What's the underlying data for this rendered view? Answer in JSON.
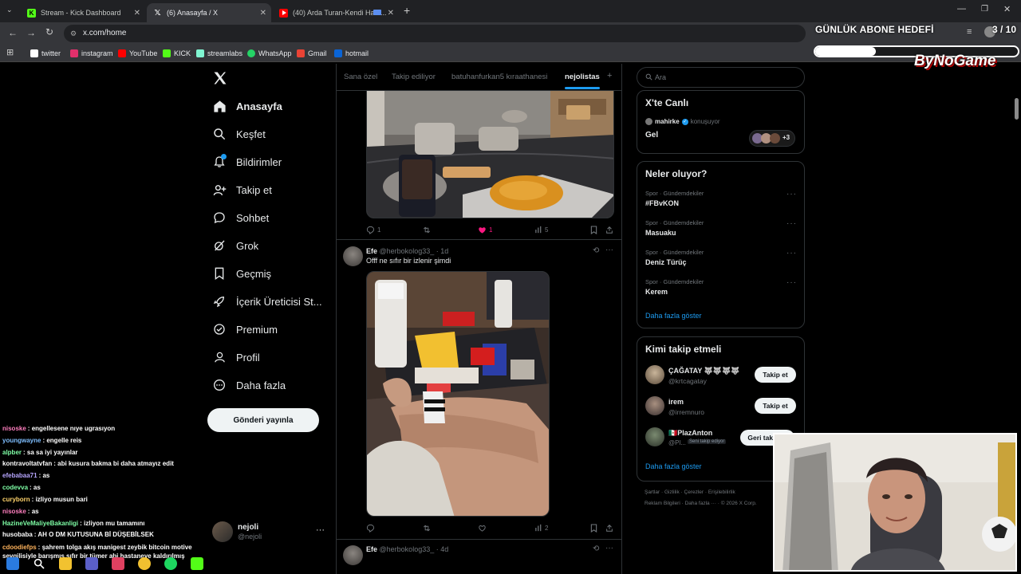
{
  "browser": {
    "tabs": [
      {
        "label": "Stream - Kick Dashboard",
        "favicon": "kick-icon",
        "color": "#53fc18"
      },
      {
        "label": "(6) Anasayfa / X",
        "favicon": "x-icon",
        "color": "#ffffff"
      },
      {
        "label": "(40) Arda Turan-Kendi Hata...",
        "favicon": "youtube-icon",
        "color": "#ff0000"
      }
    ],
    "url": "x.com/home",
    "bookmarks": [
      {
        "label": "twitter",
        "color": "#ffffff"
      },
      {
        "label": "instagram",
        "color": "#e1306c"
      },
      {
        "label": "YouTube",
        "color": "#ff0000"
      },
      {
        "label": "KICK",
        "color": "#53fc18"
      },
      {
        "label": "streamlabs",
        "color": "#80f5d2"
      },
      {
        "label": "WhatsApp",
        "color": "#25d366"
      },
      {
        "label": "Gmail",
        "color": "#ea4335"
      },
      {
        "label": "hotmail",
        "color": "#0a64d6"
      }
    ]
  },
  "x": {
    "nav": [
      {
        "label": "Anasayfa",
        "icon": "home-icon"
      },
      {
        "label": "Keşfet",
        "icon": "search-icon"
      },
      {
        "label": "Bildirimler",
        "icon": "bell-icon"
      },
      {
        "label": "Takip et",
        "icon": "follow-icon"
      },
      {
        "label": "Sohbet",
        "icon": "chat-icon"
      },
      {
        "label": "Grok",
        "icon": "grok-icon"
      },
      {
        "label": "Geçmiş",
        "icon": "bookmark-icon"
      },
      {
        "label": "İçerik Üreticisi St...",
        "icon": "rocket-icon"
      },
      {
        "label": "Premium",
        "icon": "verified-icon"
      },
      {
        "label": "Profil",
        "icon": "person-icon"
      },
      {
        "label": "Daha fazla",
        "icon": "more-icon"
      }
    ],
    "post_button": "Gönderi yayınla",
    "account": {
      "name": "nejoli",
      "handle": "@nejoli"
    },
    "feed_tabs": [
      "Sana özel",
      "Takip ediliyor",
      "batuhanfurkan5 kıraathanesi",
      "nejolistas"
    ],
    "feed_tab_add": "+",
    "posts": [
      {
        "actions": {
          "replies": "1",
          "likes": "1",
          "views": "5"
        }
      },
      {
        "author": "Efe",
        "handle": "@herbokolog33_",
        "time": "· 1d",
        "text": "Offf ne sıfır bir izlenir şimdi",
        "actions": {
          "replies": "",
          "likes": "",
          "views": "2"
        }
      },
      {
        "author": "Efe",
        "handle": "@herbokolog33_",
        "time": "· 4d"
      }
    ],
    "search_placeholder": "Ara",
    "live": {
      "title": "X'te Canlı",
      "host": "mahirke",
      "status": "konuşuyor",
      "space_title": "Gel",
      "extra": "+3"
    },
    "trends": {
      "title": "Neler oluyor?",
      "items": [
        {
          "meta": "Spor · Gündemdekiler",
          "name": "#FBvKON"
        },
        {
          "meta": "Spor · Gündemdekiler",
          "name": "Masuaku"
        },
        {
          "meta": "Spor · Gündemdekiler",
          "name": "Deniz Türüç"
        },
        {
          "meta": "Spor · Gündemdekiler",
          "name": "Kerem"
        }
      ],
      "more": "Daha fazla göster"
    },
    "who_to_follow": {
      "title": "Kimi takip etmeli",
      "items": [
        {
          "name": "ÇAĞATAY 🐺🐺🐺🐺",
          "handle": "@krtcagatay",
          "button": "Takip et",
          "tag": ""
        },
        {
          "name": "irem",
          "handle": "@irremnuro",
          "button": "Takip et",
          "tag": ""
        },
        {
          "name": "🇲🇽PlazAnton",
          "handle": "@Pl...",
          "button": "Geri takip et",
          "tag": "Seni takip ediyor"
        }
      ],
      "more": "Daha fazla göster"
    },
    "footer": {
      "line1": [
        "Şartlar",
        "Gizlilik",
        "Çerezler",
        "Erişilebilirlik"
      ],
      "line2": [
        "Reklam Bilgileri",
        "Daha fazla ···",
        "© 2026 X Corp."
      ]
    }
  },
  "overlay": {
    "goal_label": "GÜNLÜK ABONE HEDEFİ",
    "goal_count": "3 / 10",
    "goal_progress": 0.3,
    "brand": "ByNoGame"
  },
  "chat": [
    {
      "user": "nisoske",
      "msg": "engellesene nıye ugrasıyon",
      "color": "#ff7fbf"
    },
    {
      "user": "youngwayne",
      "msg": "engelle reis",
      "color": "#7fbfff"
    },
    {
      "user": "alpber",
      "msg": "sa sa iyi yayınlar",
      "color": "#7fffa6"
    },
    {
      "user": "kontravoltatvfan",
      "msg": "abi kusura bakma bi daha atmayız edit",
      "color": "#ffffff"
    },
    {
      "user": "efebabaa71",
      "msg": "as",
      "color": "#b7a6ff"
    },
    {
      "user": "codevva",
      "msg": "as",
      "color": "#7fffa6"
    },
    {
      "user": "curyborn",
      "msg": "izliyo musun bari",
      "color": "#ffd36b"
    },
    {
      "user": "nisoske",
      "msg": "as",
      "color": "#ff7fbf"
    },
    {
      "user": "HazineVeMaliyeBakanligi",
      "msg": "izliyon mu tamamını",
      "color": "#7fffa6"
    },
    {
      "user": "husobaba",
      "msg": "AH O DM KUTUSUNA Bİ DÜŞEBİLSEK",
      "color": "#ffffff"
    },
    {
      "user": "cdoodiefps",
      "msg": "şahrem tolga akış manigest zeybik bitcoin motive sevgilisiyle barışmış sıfır bir tümer abi hastaneye kaldırılmış",
      "color": "#ffb35c"
    }
  ]
}
